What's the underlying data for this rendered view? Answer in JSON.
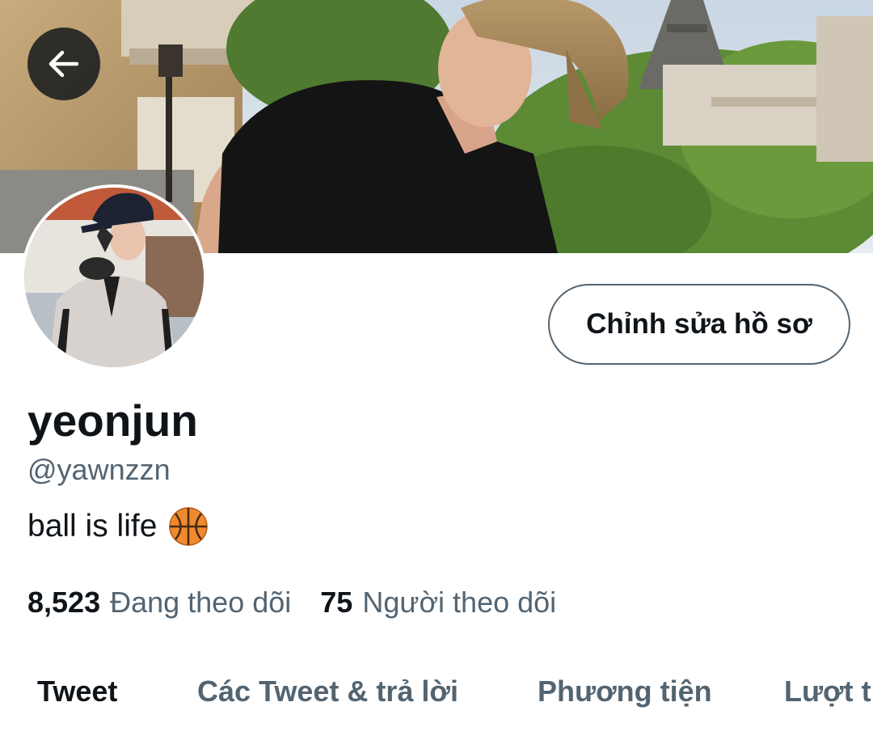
{
  "header": {
    "back_icon": "arrow-left-icon",
    "banner_description_icon": "profile-banner-image"
  },
  "profile": {
    "display_name": "yeonjun",
    "handle": "@yawnzzn",
    "bio": "ball is life",
    "bio_emoji_icon": "basketball-icon",
    "edit_button_label": "Chỉnh sửa hồ sơ"
  },
  "stats": {
    "following_count": "8,523",
    "following_label": "Đang theo dõi",
    "followers_count": "75",
    "followers_label": "Người theo dõi"
  },
  "tabs": [
    {
      "label": "Tweet",
      "active": true
    },
    {
      "label": "Các Tweet & trả lời",
      "active": false
    },
    {
      "label": "Phương tiện",
      "active": false
    },
    {
      "label": "Lượt thích",
      "active": false
    }
  ],
  "colors": {
    "text_primary": "#0f1419",
    "text_secondary": "#536471",
    "background": "#ffffff"
  }
}
